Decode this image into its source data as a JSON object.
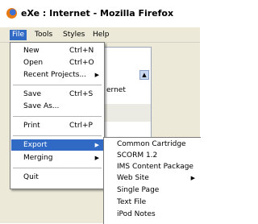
{
  "window": {
    "title": "eXe : Internet - Mozilla Firefox",
    "icon": "firefox-icon"
  },
  "menubar": {
    "file": "File",
    "tools": "Tools",
    "styles": "Styles",
    "help": "Help"
  },
  "background": {
    "panel_text_fragment": "ernet",
    "scroll_arrow": "▲"
  },
  "file_menu": {
    "new": {
      "label": "New",
      "shortcut": "Ctrl+N"
    },
    "open": {
      "label": "Open",
      "shortcut": "Ctrl+O"
    },
    "recent": {
      "label": "Recent Projects...",
      "arrow": "▶"
    },
    "save": {
      "label": "Save",
      "shortcut": "Ctrl+S"
    },
    "save_as": {
      "label": "Save As..."
    },
    "print": {
      "label": "Print",
      "shortcut": "Ctrl+P"
    },
    "export": {
      "label": "Export",
      "arrow": "▶"
    },
    "merging": {
      "label": "Merging",
      "arrow": "▶"
    },
    "quit": {
      "label": "Quit"
    }
  },
  "export_submenu": {
    "common_cartridge": "Common Cartridge",
    "scorm": "SCORM 1.2",
    "ims": "IMS Content Package",
    "web_site": "Web Site",
    "web_site_arrow": "▶",
    "single_page": "Single Page",
    "text_file": "Text File",
    "ipod_notes": "iPod Notes"
  }
}
